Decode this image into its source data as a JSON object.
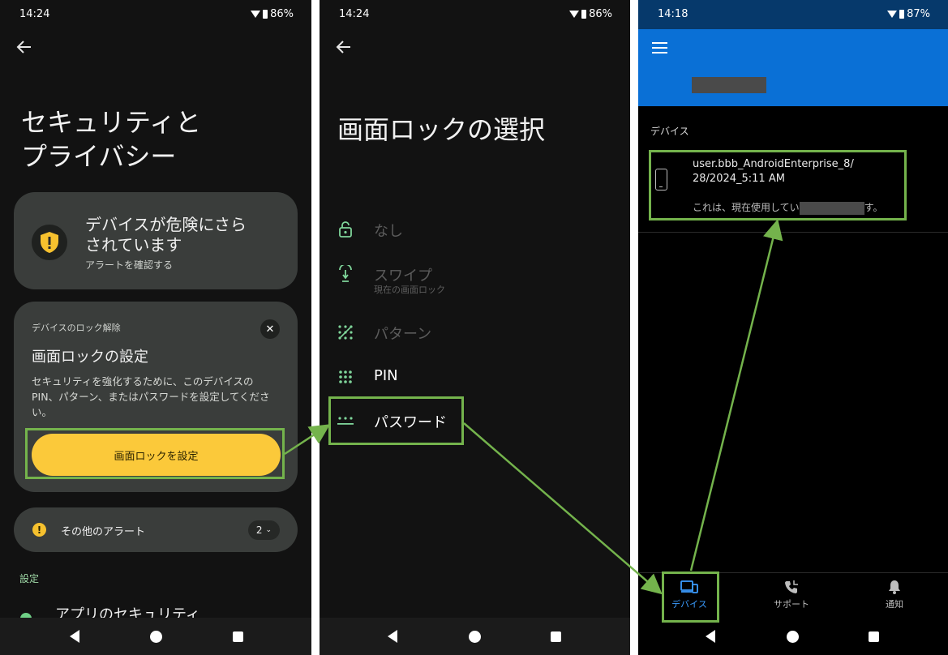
{
  "screen1": {
    "status": {
      "time": "14:24",
      "battery": "86%"
    },
    "title": "セキュリティと\nプライバシー",
    "alert_card": {
      "title": "デバイスが危険にさら\nされています",
      "subtitle": "アラートを確認する"
    },
    "lock_card": {
      "eyebrow": "デバイスのロック解除",
      "heading": "画面ロックの設定",
      "body": "セキュリティを強化するために、このデバイスの PIN、パターン、またはパスワードを設定してください。",
      "button": "画面ロックを設定"
    },
    "other_alerts": {
      "label": "その他のアラート",
      "count": "2"
    },
    "settings_label": "設定",
    "app_security": "アプリのセキュリティ"
  },
  "screen2": {
    "status": {
      "time": "14:24",
      "battery": "86%"
    },
    "title": "画面ロックの選択",
    "options": [
      {
        "label": "なし",
        "sub": "",
        "icon": "lock-open-icon"
      },
      {
        "label": "スワイプ",
        "sub": "現在の画面ロック",
        "icon": "swipe-icon"
      },
      {
        "label": "パターン",
        "sub": "",
        "icon": "pattern-icon"
      },
      {
        "label": "PIN",
        "sub": "",
        "icon": "pin-icon"
      },
      {
        "label": "パスワード",
        "sub": "",
        "icon": "password-icon"
      }
    ]
  },
  "screen3": {
    "status": {
      "time": "14:18",
      "battery": "87%"
    },
    "section_label": "デバイス",
    "device": {
      "name": "user.bbb_AndroidEnterprise_8/28/2024_5:11 AM",
      "desc_prefix": "これは、現在使用してい",
      "desc_suffix": "す。"
    },
    "tabs": [
      {
        "label": "デバイス",
        "icon": "devices-icon"
      },
      {
        "label": "サポート",
        "icon": "phone-support-icon"
      },
      {
        "label": "通知",
        "icon": "bell-icon"
      }
    ]
  },
  "colors": {
    "highlight": "#74b34c",
    "accent_blue": "#0a70d6",
    "button_yellow": "#fbc93a"
  }
}
